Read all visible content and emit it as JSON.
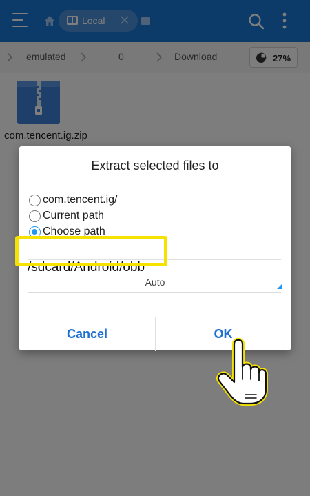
{
  "appbar": {
    "tab_label": "Local",
    "icons": [
      "menu-icon",
      "home-icon",
      "folder-icon",
      "close-icon",
      "window-icon",
      "search-icon",
      "more-vert-icon"
    ]
  },
  "breadcrumb": {
    "segments": [
      "emulated",
      "0",
      "Download"
    ],
    "storage_percent": "27%"
  },
  "files": [
    {
      "name": "com.tencent.ig.zip",
      "icon": "zip-file-icon"
    }
  ],
  "dialog": {
    "title": "Extract selected files to",
    "options": [
      {
        "label": "com.tencent.ig/",
        "checked": false
      },
      {
        "label": "Current path",
        "checked": false
      },
      {
        "label": "Choose path",
        "checked": true
      }
    ],
    "path_value": "/sdcard/Android/obb",
    "encoding_value": "Auto",
    "cancel_label": "Cancel",
    "ok_label": "OK"
  },
  "colors": {
    "appbar": "#1976d2",
    "accent": "#2196f3",
    "button_text": "#1e6fd1",
    "highlight": "#f5e200"
  }
}
